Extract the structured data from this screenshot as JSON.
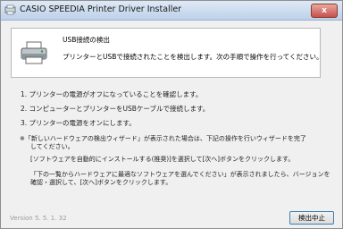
{
  "window": {
    "title": "CASIO SPEEDIA Printer Driver Installer",
    "close_label": "x"
  },
  "header": {
    "title": "USB接続の検出",
    "description": "プリンターとUSBで接続されたことを検出します。次の手順で操作を行ってください。"
  },
  "steps": [
    "1. プリンターの電源がオフになっていることを確認します。",
    "2. コンピューターとプリンターをUSBケーブルで接続します。",
    "3. プリンターの電源をオンにします。"
  ],
  "note": {
    "line1": "※「新しいハードウェアの検出ウィザード」が表示された場合は、下記の操作を行いウィザードを完了",
    "line2": "してください。",
    "para1": "[ソフトウェアを自動的にインストールする(推奨)]を選択して[次へ]ボタンをクリックします。",
    "para2_line1": "「下の一覧からハードウェアに最適なソフトウェアを選んでください」が表示されましたら、バージョンを",
    "para2_line2": "確認・選択して、[次へ]ボタンをクリックします。"
  },
  "footer": {
    "version": "Version 5. 5. 1. 32",
    "cancel_label": "検出中止"
  },
  "icons": {
    "title": "installer-icon",
    "header": "printer-icon"
  }
}
